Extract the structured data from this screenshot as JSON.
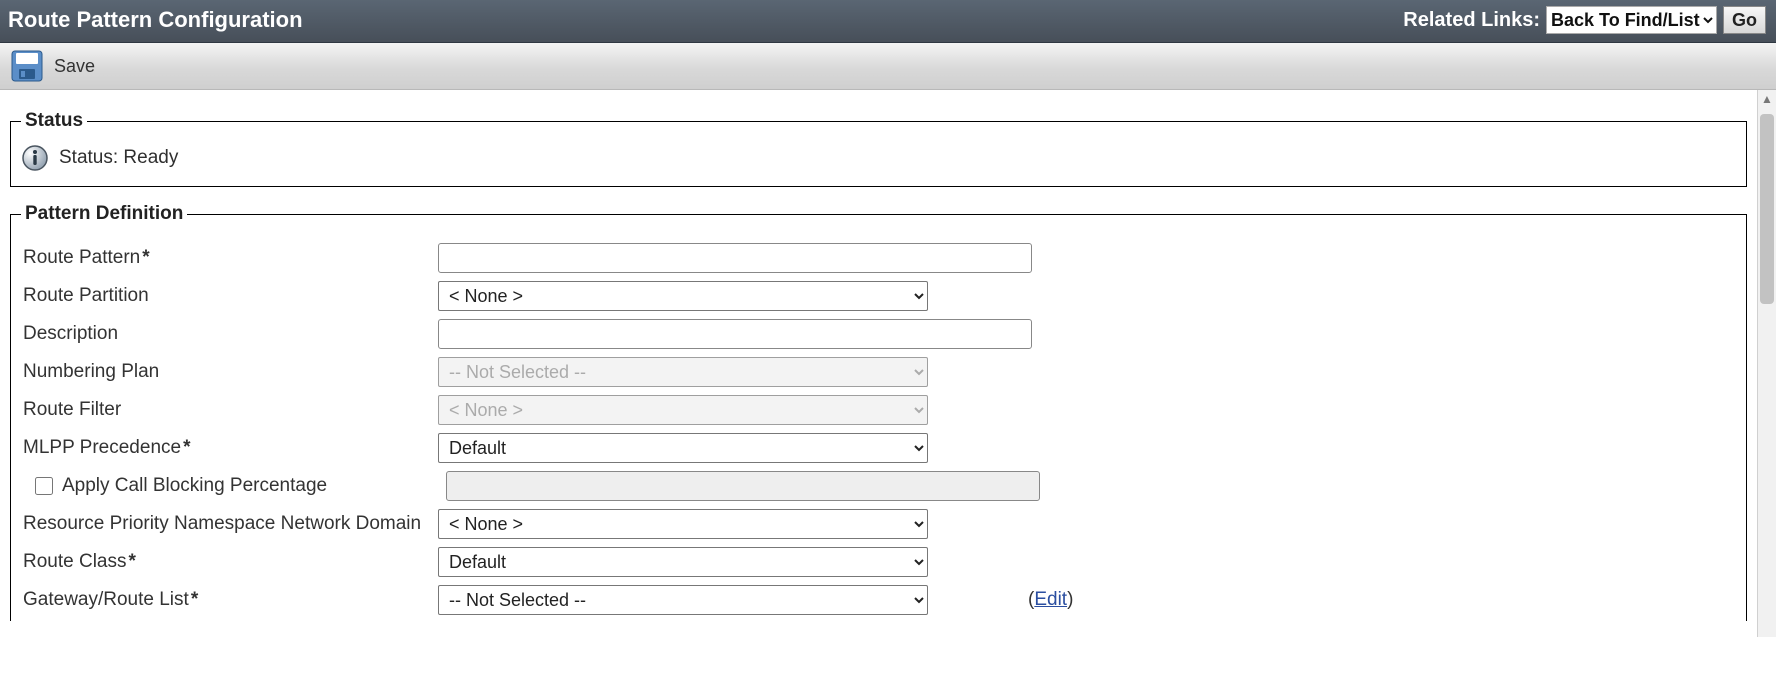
{
  "header": {
    "title": "Route Pattern Configuration",
    "related_links_label": "Related Links:",
    "related_links_selected": "Back To Find/List",
    "go_label": "Go"
  },
  "toolbar": {
    "save_label": "Save"
  },
  "status": {
    "legend": "Status",
    "text": "Status: Ready"
  },
  "pattern_def": {
    "legend": "Pattern Definition",
    "labels": {
      "route_pattern": "Route Pattern",
      "route_partition": "Route Partition",
      "description": "Description",
      "numbering_plan": "Numbering Plan",
      "route_filter": "Route Filter",
      "mlpp_precedence": "MLPP Precedence",
      "apply_call_blocking": "Apply Call Blocking Percentage",
      "rpn_domain": "Resource Priority Namespace Network Domain",
      "route_class": "Route Class",
      "gateway_route_list": "Gateway/Route List",
      "edit": "Edit"
    },
    "values": {
      "route_pattern": "",
      "route_partition": "< None >",
      "description": "",
      "numbering_plan": "-- Not Selected --",
      "route_filter": "< None >",
      "mlpp_precedence": "Default",
      "rpn_domain": "< None >",
      "route_class": "Default",
      "gateway_route_list": "-- Not Selected --",
      "apply_call_blocking_checked": false,
      "call_blocking_pct": ""
    }
  }
}
